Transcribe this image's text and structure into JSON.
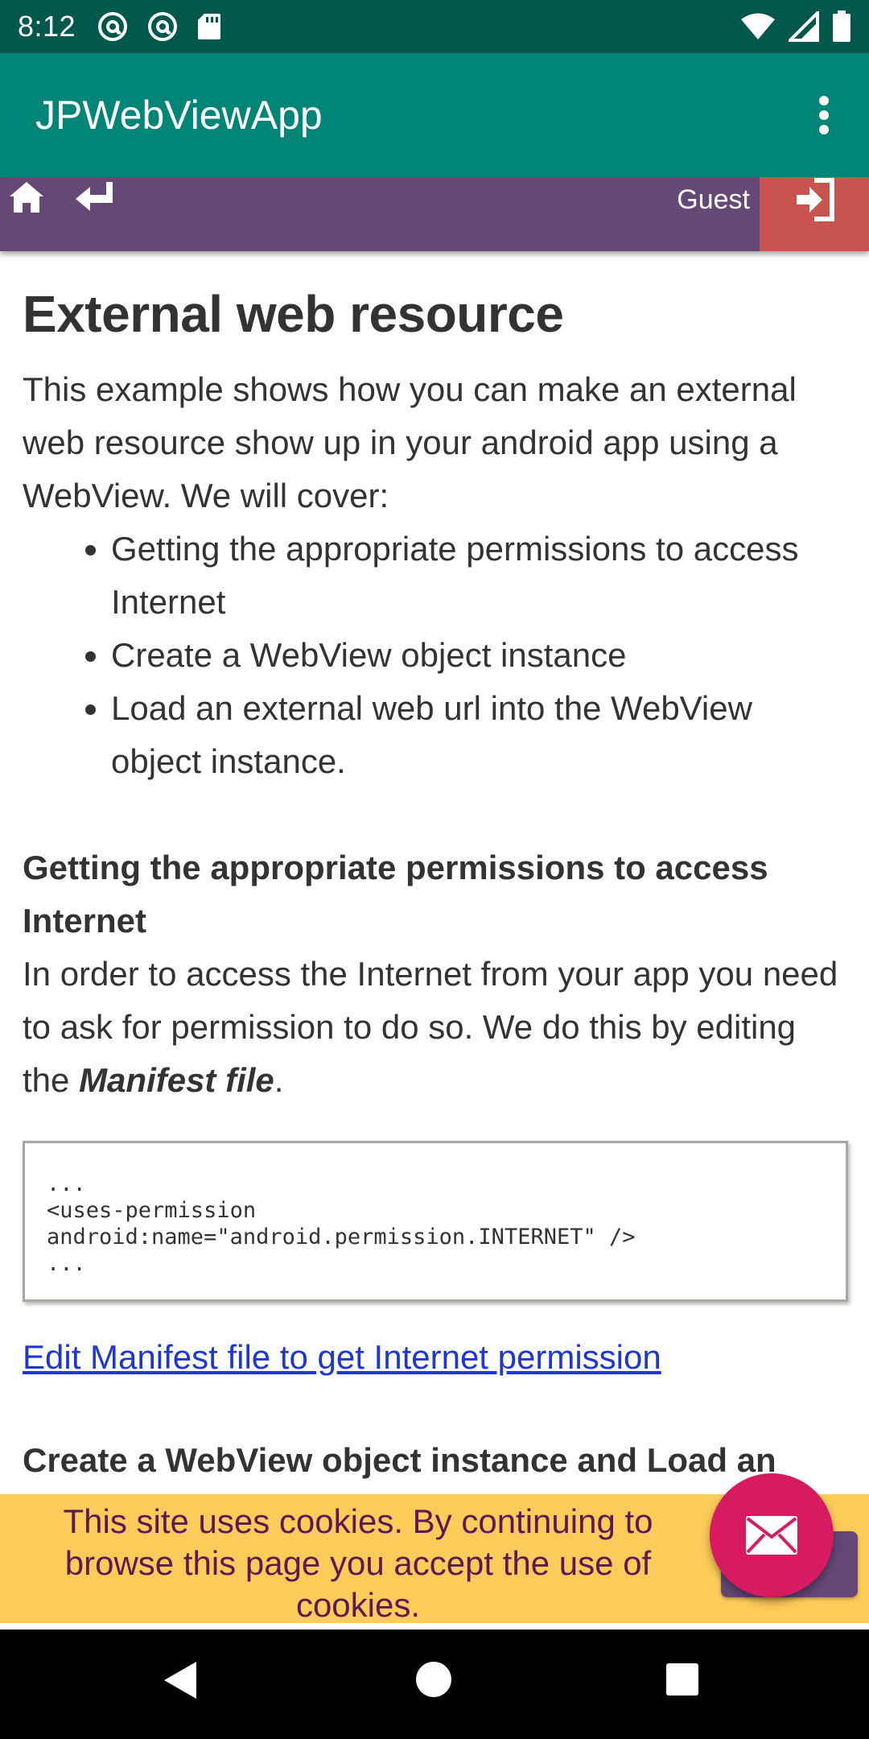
{
  "status_bar": {
    "time": "8:12"
  },
  "app_bar": {
    "title": "JPWebViewApp"
  },
  "web_nav": {
    "user_label": "Guest"
  },
  "article": {
    "title": "External web resource",
    "intro": "This example shows how you can make an external web resource show up in your android app using a WebView. We will cover:",
    "bullets": [
      "Getting the appropriate permissions to access Internet",
      "Create a WebView object instance",
      "Load an external web url into the WebView object instance."
    ],
    "section1_heading": "Getting the appropriate permissions to access Internet",
    "section1_text_before": "In order to access the Internet from your app you need to ask for permission to do so. We do this by editing the ",
    "section1_text_emphasis": "Manifest file",
    "section1_text_after": ".",
    "code_lines": [
      "...",
      "<uses-permission",
      "android:name=\"android.permission.INTERNET\" />",
      "..."
    ],
    "link_text": "Edit Manifest file to get Internet permission",
    "section2_heading": "Create a WebView object instance and Load an"
  },
  "cookie_banner": {
    "text": "This site uses cookies. By continuing to browse this page you accept the use of cookies."
  },
  "colors": {
    "status_bar": "#00574b",
    "app_bar": "#008577",
    "web_nav": "#654876",
    "login_button": "#c9534f",
    "cookie_banner": "#fdcb5a",
    "fab": "#d81b60"
  },
  "icons": {
    "status_left": [
      "at-sign-icon",
      "at-sign-icon",
      "sd-card-icon"
    ],
    "status_right": [
      "wifi-icon",
      "cell-signal-icon",
      "battery-icon"
    ],
    "app_bar": [
      "overflow-menu-icon"
    ],
    "web_nav": [
      "home-icon",
      "back-arrow-icon",
      "login-icon"
    ],
    "fab": "mail-icon",
    "system_nav": [
      "back-triangle-icon",
      "home-circle-icon",
      "recents-square-icon"
    ]
  }
}
